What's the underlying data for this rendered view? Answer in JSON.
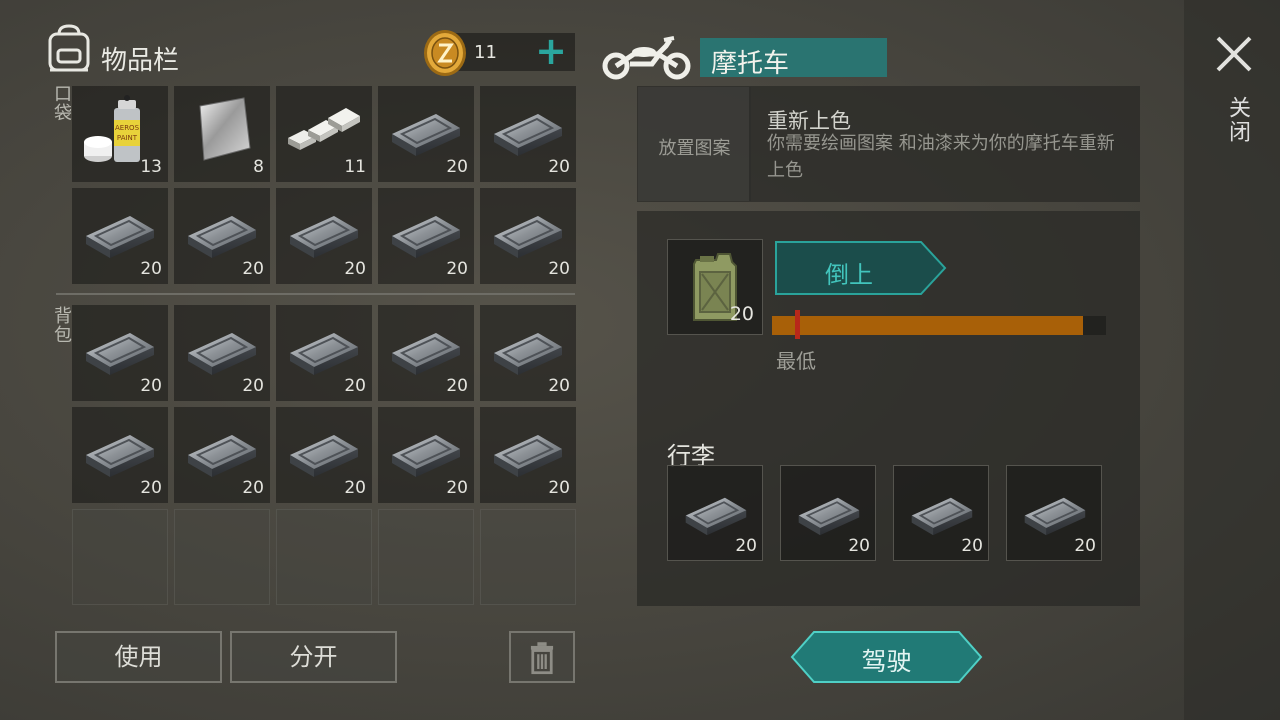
{
  "inventory": {
    "title": "物品栏",
    "coins": "11",
    "add_coins": "+",
    "pocket_label": "口袋",
    "backpack_label": "背包",
    "pocket_slots": [
      {
        "item": "spray-paint",
        "qty": "13"
      },
      {
        "item": "metal-sheet",
        "qty": "8"
      },
      {
        "item": "aluminum-ingots",
        "qty": "11"
      },
      {
        "item": "iron-bar",
        "qty": "20"
      },
      {
        "item": "iron-bar",
        "qty": "20"
      },
      {
        "item": "iron-bar",
        "qty": "20"
      },
      {
        "item": "iron-bar",
        "qty": "20"
      },
      {
        "item": "iron-bar",
        "qty": "20"
      },
      {
        "item": "iron-bar",
        "qty": "20"
      },
      {
        "item": "iron-bar",
        "qty": "20"
      }
    ],
    "backpack_slots": [
      {
        "item": "iron-bar",
        "qty": "20"
      },
      {
        "item": "iron-bar",
        "qty": "20"
      },
      {
        "item": "iron-bar",
        "qty": "20"
      },
      {
        "item": "iron-bar",
        "qty": "20"
      },
      {
        "item": "iron-bar",
        "qty": "20"
      },
      {
        "item": "iron-bar",
        "qty": "20"
      },
      {
        "item": "iron-bar",
        "qty": "20"
      },
      {
        "item": "iron-bar",
        "qty": "20"
      },
      {
        "item": "iron-bar",
        "qty": "20"
      },
      {
        "item": "iron-bar",
        "qty": "20"
      },
      {
        "item": "empty",
        "qty": ""
      },
      {
        "item": "empty",
        "qty": ""
      },
      {
        "item": "empty",
        "qty": ""
      },
      {
        "item": "empty",
        "qty": ""
      },
      {
        "item": "empty",
        "qty": ""
      }
    ],
    "use_label": "使用",
    "split_label": "分开",
    "trash_icon": "trash-icon"
  },
  "vehicle": {
    "title": "摩托车",
    "icon": "motorcycle-icon",
    "paint": {
      "slot_label": "放置图案",
      "title": "重新上色",
      "description": "你需要绘画图案 和油漆来为你的摩托车重新上色"
    },
    "fuel": {
      "item": "jerry-can",
      "qty": "20",
      "pour_label": "倒上",
      "level": 0.93,
      "min_level": 0.07,
      "min_label": "最低"
    },
    "luggage_label": "行李",
    "luggage_slots": [
      {
        "item": "iron-bar",
        "qty": "20"
      },
      {
        "item": "iron-bar",
        "qty": "20"
      },
      {
        "item": "iron-bar",
        "qty": "20"
      },
      {
        "item": "iron-bar",
        "qty": "20"
      }
    ],
    "drive_label": "驾驶"
  },
  "close_label": "关闭",
  "colors": {
    "accent_teal": "#2a7471",
    "teal_text": "#42c4bc",
    "fuel_orange": "#a86008",
    "min_marker_red": "#b8281a"
  }
}
